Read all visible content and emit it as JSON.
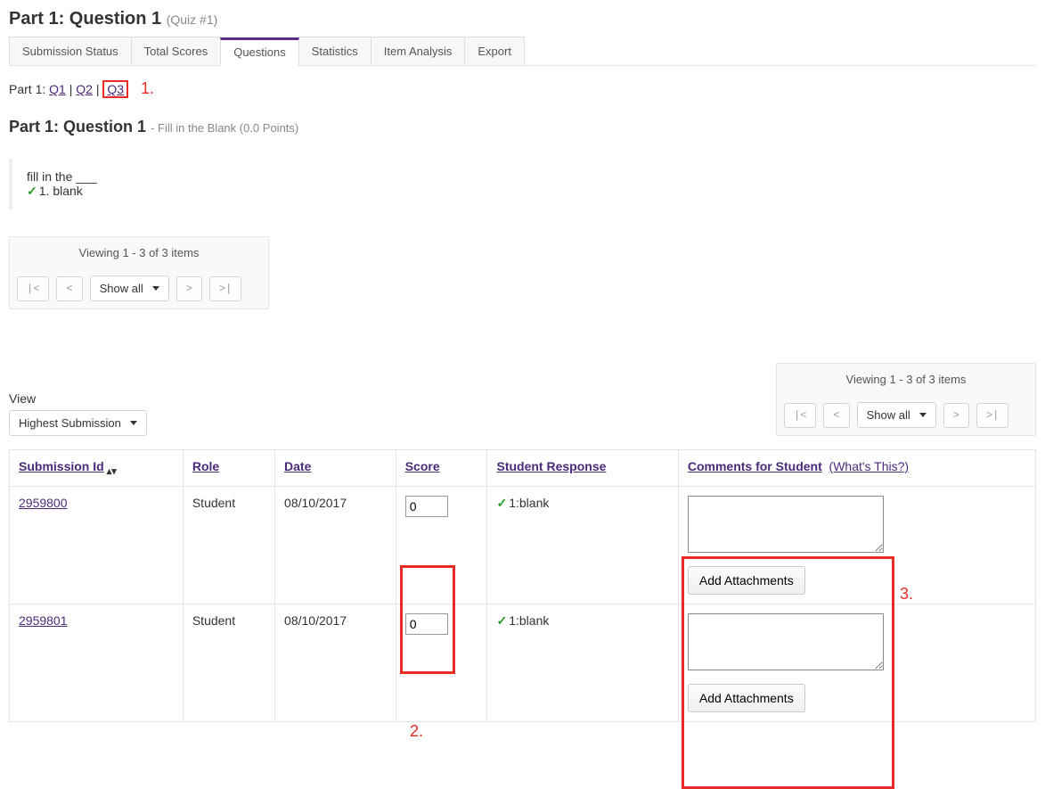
{
  "page": {
    "title": "Part 1: Question 1",
    "subtitle": "(Quiz #1)"
  },
  "tabs": {
    "items": [
      {
        "label": "Submission Status"
      },
      {
        "label": "Total Scores"
      },
      {
        "label": "Questions"
      },
      {
        "label": "Statistics"
      },
      {
        "label": "Item Analysis"
      },
      {
        "label": "Export"
      }
    ]
  },
  "nav": {
    "part_label": "Part 1:",
    "q1": "Q1",
    "q2": "Q2",
    "q3": "Q3",
    "sep": " | ",
    "annot1": "1."
  },
  "question": {
    "title": "Part 1: Question 1",
    "type_points": "- Fill in the Blank (0.0 Points)",
    "prompt": "fill in the ___",
    "answer_num": "1. ",
    "answer_text": "blank"
  },
  "pager": {
    "viewing": "Viewing 1 - 3 of 3 items",
    "first": "|<",
    "prev": "<",
    "next": ">",
    "last": ">|",
    "show_all": "Show all"
  },
  "view": {
    "label": "View",
    "selected": "Highest Submission"
  },
  "table": {
    "headers": {
      "submission_id": "Submission Id",
      "role": "Role",
      "date": "Date",
      "score": "Score",
      "student_response": "Student Response",
      "comments": "Comments for Student",
      "whats_this": "(What's This?)"
    },
    "rows": [
      {
        "id": "2959800",
        "role": "Student",
        "date": "08/10/2017",
        "score": "0",
        "response": "1:blank"
      },
      {
        "id": "2959801",
        "role": "Student",
        "date": "08/10/2017",
        "score": "0",
        "response": "1:blank"
      }
    ],
    "add_attachments": "Add Attachments"
  },
  "annotations": {
    "a2": "2.",
    "a3": "3."
  }
}
